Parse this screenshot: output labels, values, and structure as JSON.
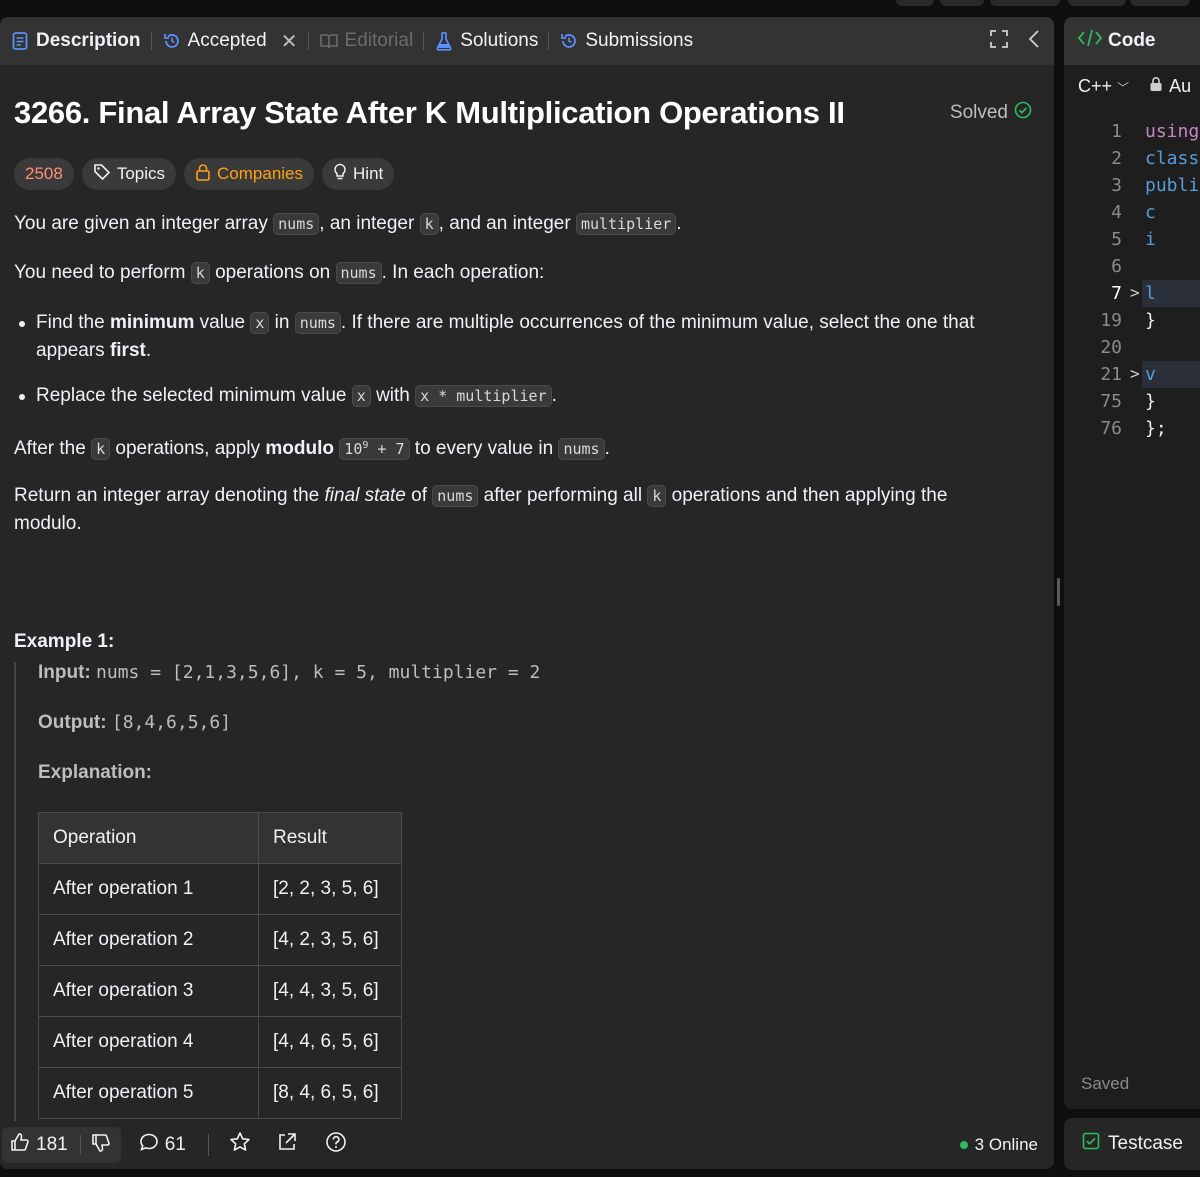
{
  "tabs": [
    {
      "label": "Description",
      "icon": "document-icon",
      "active": true
    },
    {
      "label": "Accepted",
      "icon": "history-icon",
      "closable": true
    },
    {
      "label": "Editorial",
      "icon": "book-icon",
      "disabled": true
    },
    {
      "label": "Solutions",
      "icon": "flask-icon"
    },
    {
      "label": "Submissions",
      "icon": "history-icon"
    }
  ],
  "problem": {
    "title": "3266. Final Array State After K Multiplication Operations II",
    "solved_label": "Solved",
    "chips": {
      "difficulty_score": "2508",
      "topics": "Topics",
      "companies": "Companies",
      "hint": "Hint"
    }
  },
  "desc": {
    "p1": [
      "You are given an integer array ",
      "nums",
      ", an integer ",
      "k",
      ", and an integer ",
      "multiplier",
      "."
    ],
    "p2": [
      "You need to perform ",
      "k",
      " operations on ",
      "nums",
      ". In each operation:"
    ],
    "b1": [
      "Find the ",
      "minimum",
      " value ",
      "x",
      " in ",
      "nums",
      ". If there are multiple occurrences of the minimum value, select the one that appears ",
      "first",
      "."
    ],
    "b2": [
      "Replace the selected minimum value ",
      "x",
      " with ",
      "x * multiplier",
      "."
    ],
    "p3": [
      "After the ",
      "k",
      " operations, apply ",
      "modulo",
      "10",
      "9",
      " + 7",
      " to every value in ",
      "nums",
      "."
    ],
    "p4": [
      "Return an integer array denoting the ",
      "final state",
      " of ",
      "nums",
      " after performing all ",
      "k",
      " operations and then applying the modulo."
    ]
  },
  "example": {
    "title": "Example 1:",
    "input_label": "Input:",
    "input_value": "nums = [2,1,3,5,6], k = 5, multiplier = 2",
    "output_label": "Output:",
    "output_value": "[8,4,6,5,6]",
    "explanation_label": "Explanation:",
    "table_headers": [
      "Operation",
      "Result"
    ],
    "table_rows": [
      [
        "After operation 1",
        "[2, 2, 3, 5, 6]"
      ],
      [
        "After operation 2",
        "[4, 2, 3, 5, 6]"
      ],
      [
        "After operation 3",
        "[4, 4, 3, 5, 6]"
      ],
      [
        "After operation 4",
        "[4, 4, 6, 5, 6]"
      ],
      [
        "After operation 5",
        "[8, 4, 6, 5, 6]"
      ]
    ]
  },
  "bottom": {
    "likes": "181",
    "comments": "61",
    "online": "3 Online"
  },
  "code_panel": {
    "title": "Code",
    "language": "C++",
    "auto_label": "Au",
    "lines": [
      {
        "n": "1",
        "t": "using"
      },
      {
        "n": "2",
        "t": "class"
      },
      {
        "n": "3",
        "t": "publi"
      },
      {
        "n": "4",
        "t": "    c"
      },
      {
        "n": "5",
        "t": "    i"
      },
      {
        "n": "6",
        "t": ""
      },
      {
        "n": "7",
        "t": "    l",
        "folded": true
      },
      {
        "n": "19",
        "t": "    }"
      },
      {
        "n": "20",
        "t": ""
      },
      {
        "n": "21",
        "t": "    v",
        "folded": true
      },
      {
        "n": "75",
        "t": "    }"
      },
      {
        "n": "76",
        "t": "};"
      }
    ],
    "saved": "Saved",
    "testcase": "Testcase"
  },
  "colors": {
    "accent": "#ffa116",
    "green": "#2cbb5d",
    "difficulty": "#ff8f7a"
  }
}
